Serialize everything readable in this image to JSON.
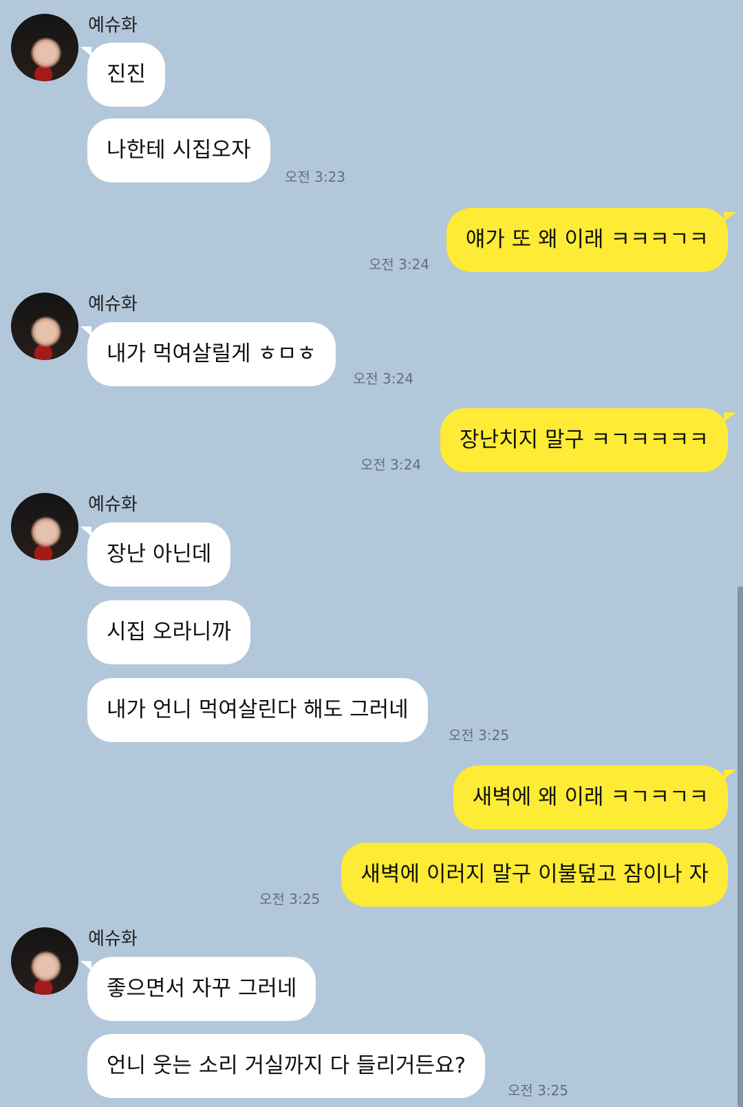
{
  "chat": {
    "partner_name": "예슈화",
    "groups": [
      {
        "sender": "예슈화",
        "messages": [
          "진진",
          "나한테 시집오자"
        ],
        "time": "오전 3:23"
      },
      {
        "sender": "me",
        "messages": [
          "얘가 또 왜 이래 ㅋㅋㅋㄱㅋ"
        ],
        "time": "오전 3:24"
      },
      {
        "sender": "예슈화",
        "messages": [
          "내가 먹여살릴게 ㅎㅁㅎ"
        ],
        "time": "오전 3:24"
      },
      {
        "sender": "me",
        "messages": [
          "장난치지 말구 ㅋㄱㅋㅋㅋㅋ"
        ],
        "time": "오전 3:24"
      },
      {
        "sender": "예슈화",
        "messages": [
          "장난 아닌데",
          "시집 오라니까",
          "내가 언니 먹여살린다 해도 그러네"
        ],
        "time": "오전 3:25"
      },
      {
        "sender": "me",
        "messages": [
          "새벽에 왜 이래 ㅋㄱㅋㄱㅋ",
          "새벽에 이러지 말구 이불덮고 잠이나 자"
        ],
        "time": "오전 3:25"
      },
      {
        "sender": "예슈화",
        "messages": [
          "좋으면서 자꾸 그러네",
          "언니 웃는 소리 거실까지 다 들리거든요?"
        ],
        "time": "오전 3:25"
      }
    ]
  },
  "colors": {
    "background": "#b2c7da",
    "incoming_bubble": "#ffffff",
    "outgoing_bubble": "#feeb35"
  }
}
